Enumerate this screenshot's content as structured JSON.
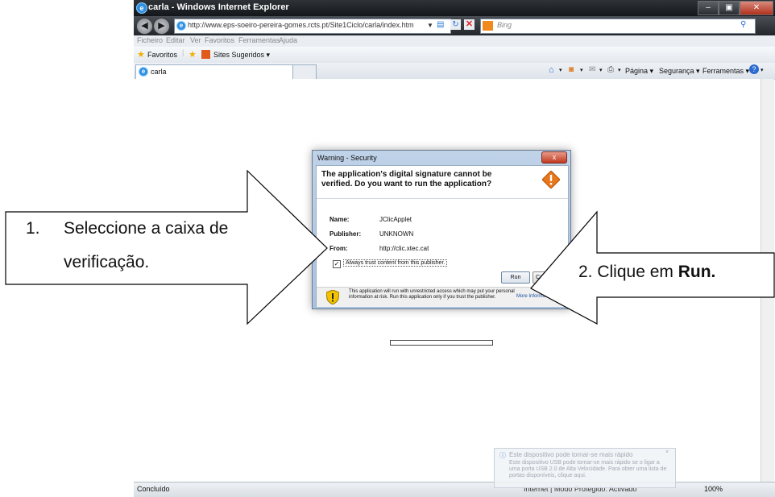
{
  "window": {
    "title": "carla - Windows Internet Explorer",
    "url": "http://www.eps-soeiro-pereira-gomes.rcts.pt/Site1Ciclo/carla/index.htm",
    "search_placeholder": "Bing"
  },
  "menu": [
    "Ficheiro",
    "Editar",
    "Ver",
    "Favoritos",
    "Ferramentas",
    "Ajuda"
  ],
  "favorites_bar": {
    "favorites_label": "Favoritos",
    "suggested_sites": "Sites Sugeridos ▾"
  },
  "tab": {
    "label": "carla"
  },
  "command_bar": {
    "page": "Página ▾",
    "security": "Segurança ▾",
    "tools": "Ferramentas ▾"
  },
  "dialog": {
    "title": "Warning - Security",
    "close": "x",
    "message": "The application's digital signature cannot be verified. Do you want to run the application?",
    "fields": [
      {
        "label": "Name:",
        "value": "JClicApplet"
      },
      {
        "label": "Publisher:",
        "value": "UNKNOWN"
      },
      {
        "label": "From:",
        "value": "http://clic.xtec.cat"
      }
    ],
    "checkbox_label": "Always trust content from this publisher.",
    "checkbox_checked": true,
    "run_button": "Run",
    "cancel_button": "Ca",
    "footer_text": "This application will run with unrestricted access which may put your personal information at risk. Run this application only if you trust the publisher.",
    "more_info": "More Information..."
  },
  "notification": {
    "title": "Este dispositivo pode tornar-se mais rápido",
    "body": "Este dispositivo USB pode tornar-se mais rápido se o ligar a uma porta USB 2.0 de Alta Velocidade. Para obter uma lista de portas disponíveis, clique aqui."
  },
  "statusbar": {
    "left": "Concluído",
    "zone": "Internet | Modo Protegido: Activado",
    "zoom": "100%"
  },
  "callouts": {
    "left_number": "1.",
    "left_line1": "Seleccione a caixa de",
    "left_line2": "verificação.",
    "right_text": "2. Clique em ",
    "right_bold": "Run."
  },
  "colors": {
    "title_bar": "#1c2024",
    "dialog_frame": "#b3c9e3",
    "warning_orange": "#e8761a"
  }
}
